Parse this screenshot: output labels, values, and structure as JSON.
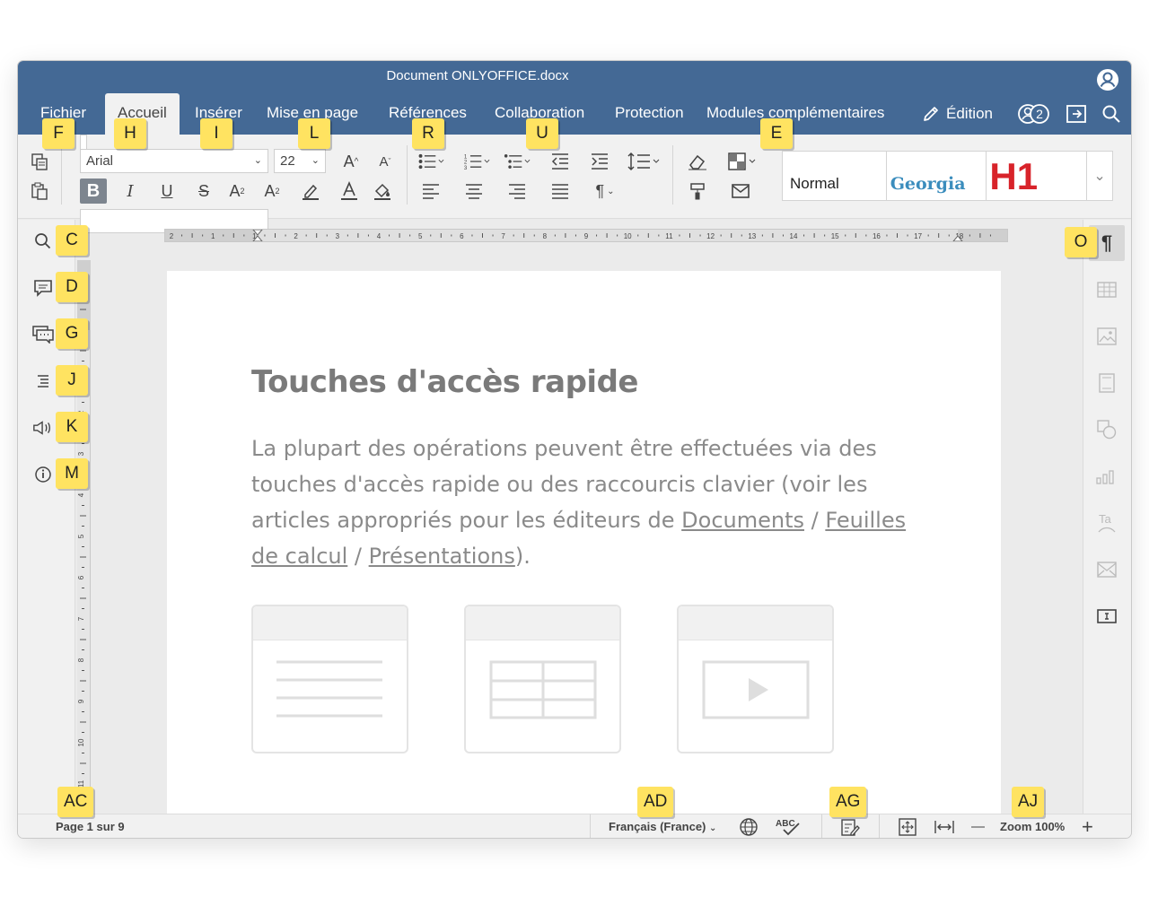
{
  "app": {
    "title": "Document ONLYOFFICE.docx"
  },
  "tabs": [
    {
      "label": "Fichier"
    },
    {
      "label": "Accueil"
    },
    {
      "label": "Insérer"
    },
    {
      "label": "Mise en page"
    },
    {
      "label": "Références"
    },
    {
      "label": "Collaboration"
    },
    {
      "label": "Protection"
    },
    {
      "label": "Modules complémentaires"
    }
  ],
  "header": {
    "edit_mode_label": "Édition",
    "users_count": "2"
  },
  "toolbar": {
    "font_name": "Arial",
    "font_size": "22",
    "styles": {
      "normal": "Normal",
      "georgia": "Georgia",
      "h1": "H1"
    },
    "pilcrow_glyph": "¶"
  },
  "document": {
    "heading": "Touches d'accès rapide",
    "paragraph_prefix": "La plupart des opérations peuvent être effectuées via des touches d'accès rapide ou des raccourcis clavier (voir les articles appropriés pour les éditeurs de ",
    "link_documents": "Documents",
    "sep1": " / ",
    "link_spreadsheets": "Feuilles de calcul",
    "sep2": " / ",
    "link_presentations": "Présentations",
    "paragraph_suffix": ")."
  },
  "statusbar": {
    "page_info": "Page 1 sur 9",
    "language": "Français  (France)",
    "zoom": "Zoom 100%",
    "zoom_minus": "—",
    "zoom_plus": "+"
  },
  "hruler_labels": [
    "2",
    "1",
    "1",
    "2",
    "3",
    "4",
    "5",
    "6",
    "7",
    "8",
    "9",
    "10",
    "11",
    "12",
    "13",
    "14",
    "15",
    "16",
    "17",
    "18"
  ],
  "vruler_labels": [
    "1",
    "2",
    "3",
    "4",
    "5",
    "6",
    "7",
    "8",
    "9",
    "10",
    "11"
  ],
  "keytips": {
    "F": "F",
    "H": "H",
    "I": "I",
    "L": "L",
    "R": "R",
    "U": "U",
    "E": "E",
    "C": "C",
    "D": "D",
    "G": "G",
    "J": "J",
    "K": "K",
    "M": "M",
    "O": "O",
    "AC": "AC",
    "AD": "AD",
    "AG": "AG",
    "AJ": "AJ"
  },
  "colors": {
    "titlebar": "#446995",
    "h1_style": "#d8232a",
    "georgia_style": "#3b8dbd",
    "keytip": "#ffe361"
  }
}
